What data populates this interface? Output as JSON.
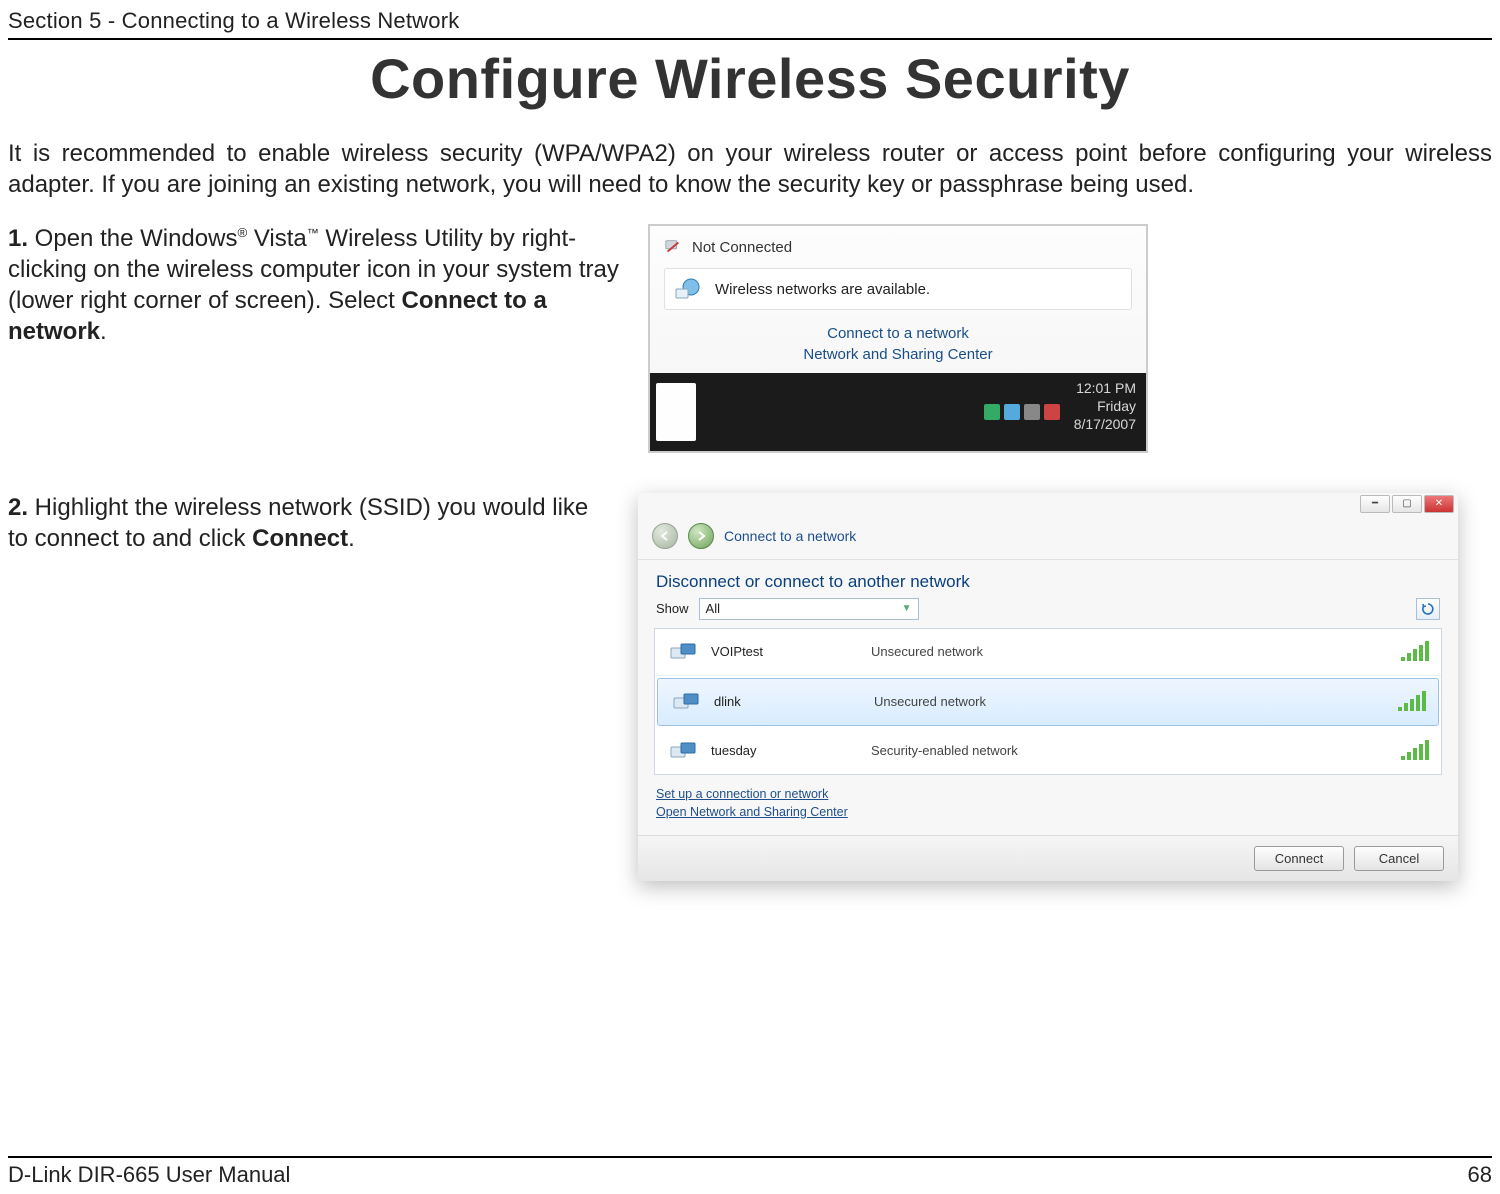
{
  "header": {
    "section": "Section 5 - Connecting to a Wireless Network"
  },
  "title": "Configure Wireless Security",
  "intro": "It is recommended to enable wireless security (WPA/WPA2) on your wireless router or access point before configuring your wireless adapter. If you are joining an existing network, you will need to know the security key or passphrase being used.",
  "step1": {
    "num": "1.",
    "text_a": " Open the Windows",
    "reg": "®",
    "text_b": " Vista",
    "tm": "™",
    "text_c": " Wireless Utility by right-clicking on the wireless computer icon in your system tray (lower right corner of screen). Select ",
    "bold": "Connect to a network",
    "text_d": "."
  },
  "shot1": {
    "not_connected": "Not Connected",
    "avail": "Wireless networks are available.",
    "link1": "Connect to a network",
    "link2": "Network and Sharing Center",
    "clock": {
      "time": "12:01 PM",
      "day": "Friday",
      "date": "8/17/2007"
    }
  },
  "step2": {
    "num": "2.",
    "text_a": " Highlight the wireless network (SSID) you would like to connect to and click ",
    "bold": "Connect",
    "text_b": "."
  },
  "shot2": {
    "crumb": "Connect to a network",
    "heading": "Disconnect or connect to another network",
    "show_label": "Show",
    "show_value": "All",
    "networks": [
      {
        "name": "VOIPtest",
        "sec": "Unsecured network"
      },
      {
        "name": "dlink",
        "sec": "Unsecured network"
      },
      {
        "name": "tuesday",
        "sec": "Security-enabled network"
      }
    ],
    "link1": "Set up a connection or network",
    "link2": "Open Network and Sharing Center",
    "btn_connect": "Connect",
    "btn_cancel": "Cancel"
  },
  "footer": {
    "manual": "D-Link DIR-665 User Manual",
    "page": "68"
  }
}
